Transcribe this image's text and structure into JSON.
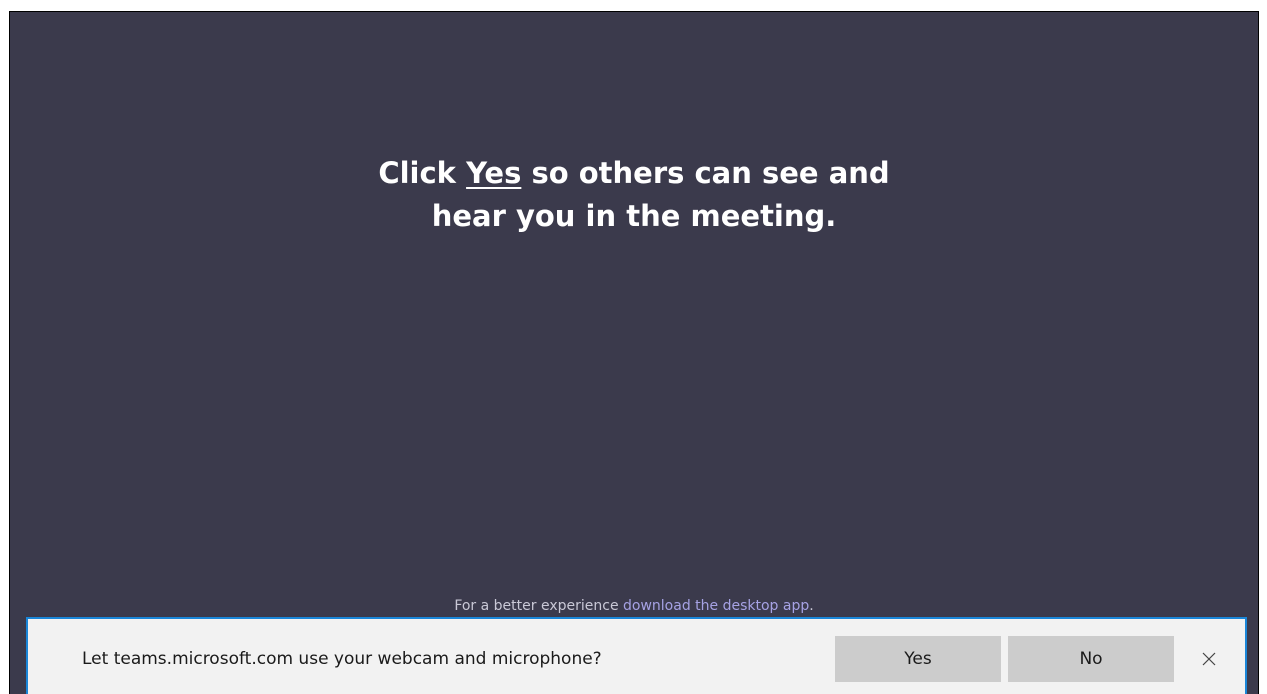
{
  "main": {
    "headline": {
      "line1_prefix": "Click ",
      "line1_emphasis": "Yes",
      "line1_suffix": " so others can see and",
      "line2": "hear you in the meeting."
    },
    "footer": {
      "text": "For a better experience ",
      "link_text": "download the desktop app",
      "suffix": "."
    }
  },
  "permission_bar": {
    "prompt": "Let teams.microsoft.com use your webcam and microphone?",
    "yes_label": "Yes",
    "no_label": "No",
    "close_icon": "close-icon"
  },
  "colors": {
    "background": "#3b3a4c",
    "link": "#a6a2e4",
    "bar_border": "#1a86d8",
    "bar_background": "#f2f2f2",
    "button": "#cccccc"
  }
}
